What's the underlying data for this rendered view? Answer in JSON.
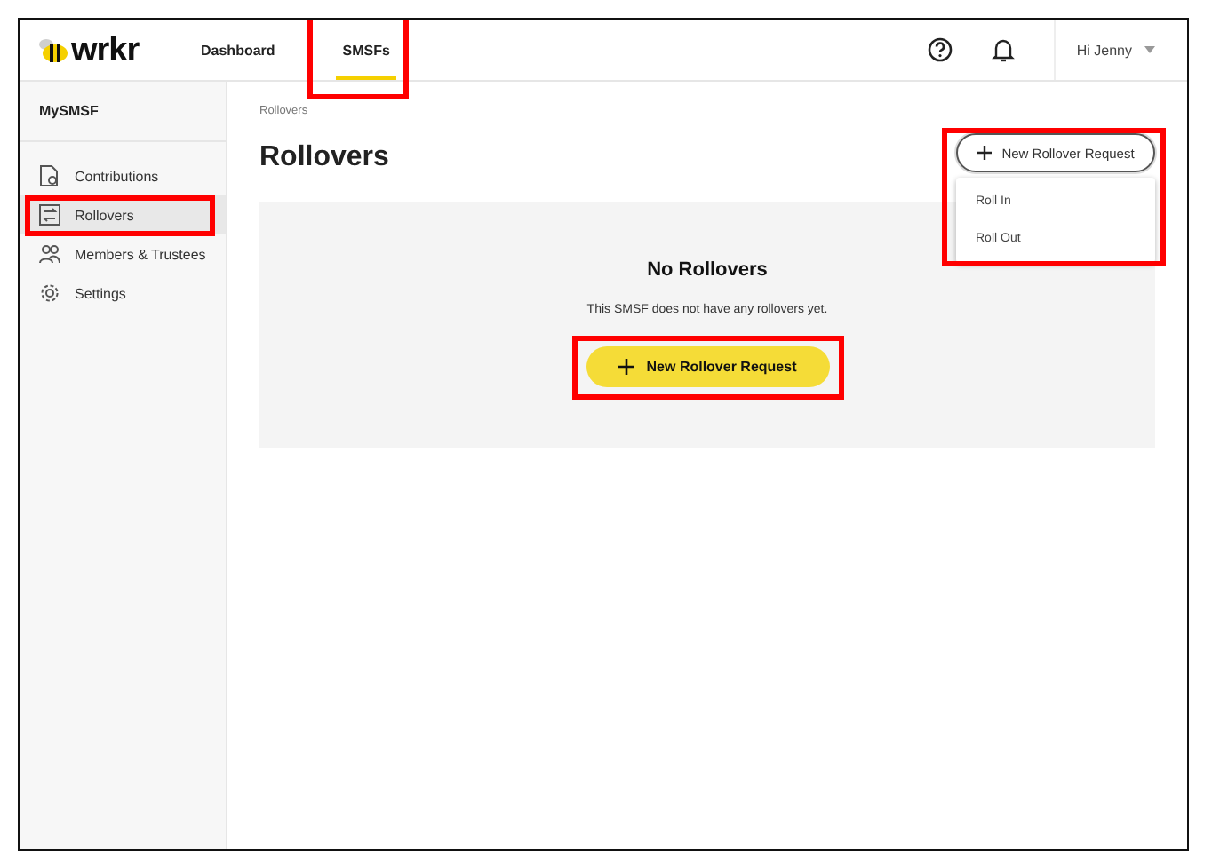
{
  "logo": {
    "text": "wrkr"
  },
  "nav": [
    {
      "label": "Dashboard",
      "selected": false,
      "highlighted": false
    },
    {
      "label": "SMSFs",
      "selected": true,
      "highlighted": true
    }
  ],
  "user_menu": {
    "label": "Hi Jenny"
  },
  "sidebar": {
    "title": "MySMSF",
    "items": [
      {
        "label": "Contributions",
        "kind": "document",
        "selected": false,
        "highlighted": false
      },
      {
        "label": "Rollovers",
        "kind": "transfer",
        "selected": true,
        "highlighted": true
      },
      {
        "label": "Members & Trustees",
        "kind": "people",
        "selected": false,
        "highlighted": false
      },
      {
        "label": "Settings",
        "kind": "gear",
        "selected": false,
        "highlighted": false
      }
    ]
  },
  "breadcrumb": "Rollovers",
  "page_title": "Rollovers",
  "new_request_menu": {
    "button": "New Rollover Request",
    "expanded": true,
    "highlighted": true,
    "options": [
      "Roll In",
      "Roll Out"
    ]
  },
  "empty_state": {
    "title": "No Rollovers",
    "message": "This SMSF does not have any rollovers yet.",
    "button": "New Rollover Request",
    "highlighted": true
  }
}
